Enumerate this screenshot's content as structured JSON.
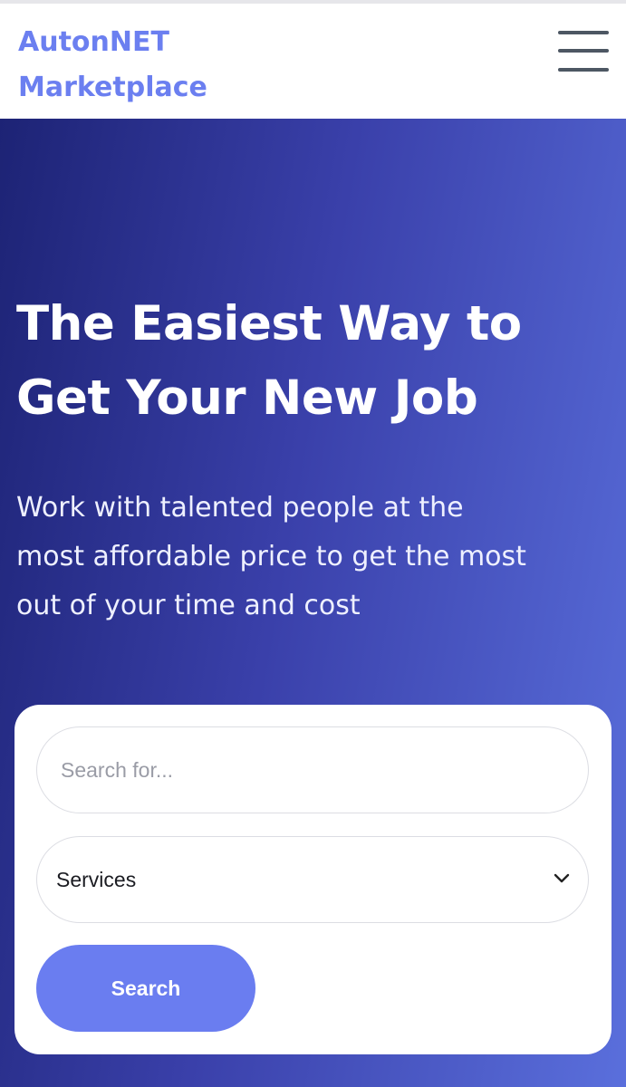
{
  "header": {
    "brand": "AutonNET\nMarketplace",
    "menu_icon": "hamburger-menu-icon"
  },
  "hero": {
    "title": "The Easiest Way to\nGet Your New Job",
    "subtitle": "Work with talented people at the\nmost affordable price to get the most\nout of your time and cost"
  },
  "search": {
    "placeholder": "Search for...",
    "value": "",
    "category_selected": "Services",
    "button_label": "Search",
    "chevron_icon": "chevron-down-icon"
  },
  "colors": {
    "brand": "#6b7ff0",
    "hero_gradient_start": "#1d2375",
    "hero_gradient_end": "#5a6fdc",
    "button": "#6a7df0"
  }
}
